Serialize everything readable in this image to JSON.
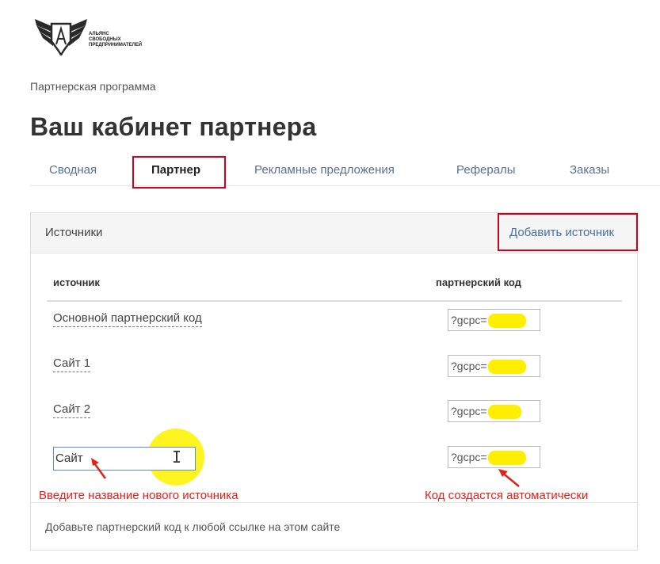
{
  "logo": {
    "icon": "winged-shield-logo-icon",
    "lines": [
      "Альянс",
      "свободных",
      "предпринимателей"
    ]
  },
  "breadcrumb": "Партнерская программа",
  "page_title": "Ваш кабинет партнера",
  "tabs": [
    {
      "label": "Сводная",
      "active": false
    },
    {
      "label": "Партнер",
      "active": true
    },
    {
      "label": "Рекламные предложения",
      "active": false
    },
    {
      "label": "Рефералы",
      "active": false
    },
    {
      "label": "Заказы",
      "active": false
    }
  ],
  "panel": {
    "title": "Источники",
    "add_label": "Добавить источник",
    "columns": {
      "source": "источник",
      "code": "партнерский код"
    },
    "rows": [
      {
        "name": "Основной партнерский код",
        "code_prefix": "?gcpc="
      },
      {
        "name": "Сайт 1",
        "code_prefix": "?gcpc="
      },
      {
        "name": "Сайт 2",
        "code_prefix": "?gcpc="
      }
    ],
    "new_row": {
      "input_value": "Сайт",
      "code_prefix": "?gcpc="
    },
    "footer": "Добавьте партнерский код к любой ссылке на этом сайте"
  },
  "annotations": {
    "left": "Введите название нового источника",
    "right": "Код создастся автоматически"
  },
  "colors": {
    "highlight_box": "#d0021b",
    "annotation": "#e0221a",
    "link": "#4a6fa0",
    "marker": "#ffee00"
  }
}
